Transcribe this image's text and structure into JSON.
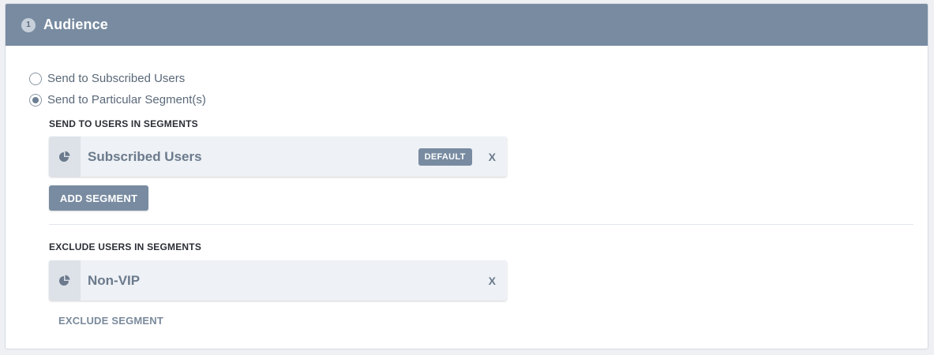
{
  "header": {
    "step_number": "1",
    "title": "Audience"
  },
  "audience_options": [
    {
      "label": "Send to Subscribed Users",
      "selected": false
    },
    {
      "label": "Send to Particular Segment(s)",
      "selected": true
    }
  ],
  "include_section": {
    "label": "SEND TO USERS IN SEGMENTS",
    "segments": [
      {
        "name": "Subscribed Users",
        "badge": "DEFAULT",
        "remove_label": "X",
        "icon": "pie-chart-icon"
      }
    ],
    "add_button_label": "ADD SEGMENT"
  },
  "exclude_section": {
    "label": "EXCLUDE USERS IN SEGMENTS",
    "segments": [
      {
        "name": "Non-VIP",
        "remove_label": "X",
        "icon": "pie-chart-icon"
      }
    ],
    "exclude_link_label": "EXCLUDE SEGMENT"
  },
  "colors": {
    "header_bg": "#788ba1",
    "button_bg": "#788ba1",
    "segment_bg": "#eef1f5"
  }
}
